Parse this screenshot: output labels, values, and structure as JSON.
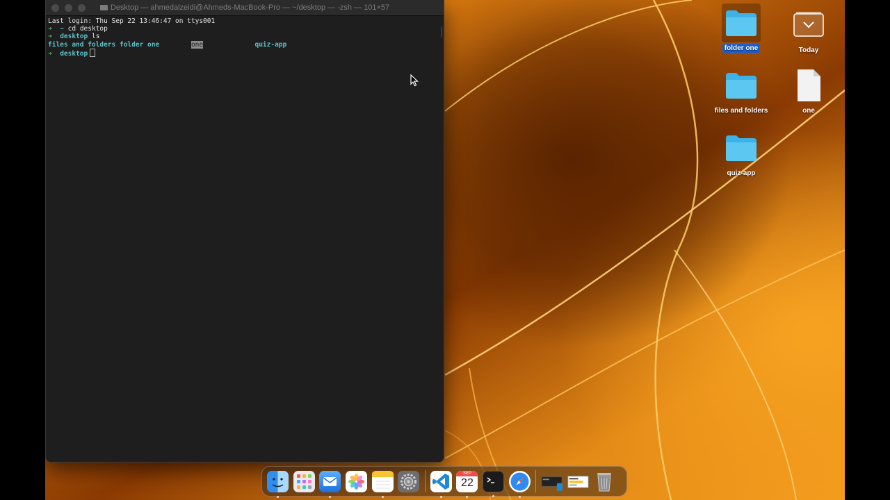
{
  "terminal": {
    "title": "Desktop — ahmedalzeidi@Ahmeds-MacBook-Pro — ~/desktop — -zsh — 101×57",
    "lines": {
      "last_login": "Last login: Thu Sep 22 13:46:47 on ttys001",
      "prompt1_arrow": "➜",
      "prompt1_path": "~",
      "prompt1_cmd": "cd desktop",
      "prompt2_arrow": "➜",
      "prompt2_path": "desktop",
      "prompt2_cmd": "ls",
      "ls_item1": "files and folders",
      "ls_item2": "folder one",
      "ls_item3": "one",
      "ls_item4": "quiz-app",
      "prompt3_arrow": "➜",
      "prompt3_path": "desktop"
    },
    "colors": {
      "background": "#1e1e1e",
      "prompt_arrow": "#4ec26f",
      "directory": "#5fc1c9"
    }
  },
  "desktop_icons": [
    {
      "label": "folder one",
      "icon": "folder-icon",
      "selected": true
    },
    {
      "label": "Today",
      "icon": "stack-icon",
      "selected": false
    },
    {
      "label": "files and folders",
      "icon": "folder-icon",
      "selected": false
    },
    {
      "label": "one",
      "icon": "document-icon",
      "selected": false
    },
    {
      "label": "quiz-app",
      "icon": "folder-icon",
      "selected": false
    }
  ],
  "dock": {
    "apps": [
      {
        "name": "finder-icon",
        "running": true
      },
      {
        "name": "launchpad-icon",
        "running": false
      },
      {
        "name": "mail-icon",
        "running": true
      },
      {
        "name": "photos-icon",
        "running": false
      },
      {
        "name": "notes-icon",
        "running": true
      },
      {
        "name": "system-settings-icon",
        "running": false
      },
      {
        "name": "vscode-icon",
        "running": true
      },
      {
        "name": "calendar-icon",
        "running": true
      },
      {
        "name": "terminal-icon",
        "running": true
      },
      {
        "name": "safari-icon",
        "running": true
      }
    ],
    "calendar": {
      "month": "SEP",
      "day": "22"
    },
    "recent": [
      "window-thumbnail-icon",
      "window-thumbnail-icon"
    ],
    "trash": "trash-icon"
  }
}
